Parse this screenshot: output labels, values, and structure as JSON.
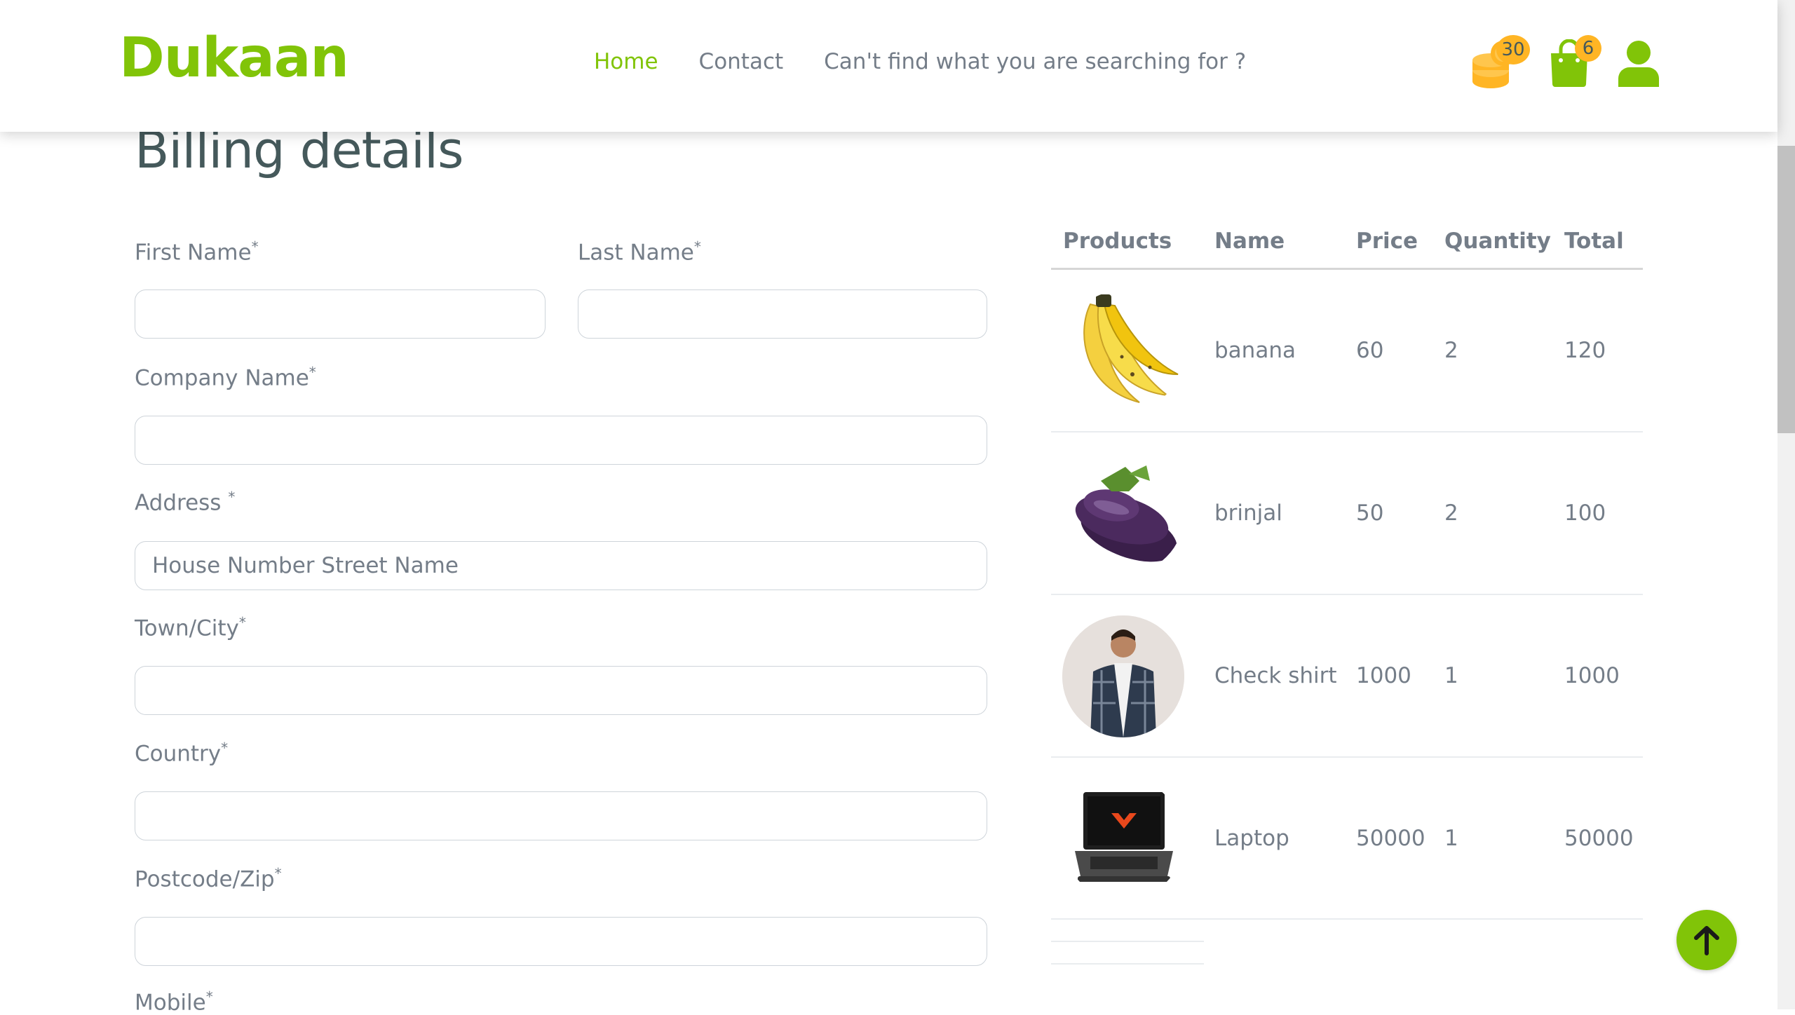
{
  "brand": {
    "logo": "Dukaan",
    "accent": "#81c408",
    "badge_color": "#ffb524"
  },
  "nav": {
    "home": "Home",
    "contact": "Contact",
    "search_prompt": "Can't find what you are searching for ?"
  },
  "header_icons": {
    "coins_count": "30",
    "cart_count": "6"
  },
  "page": {
    "title": "Billing details"
  },
  "form": {
    "first_name": "First Name",
    "last_name": "Last Name",
    "company_name": "Company Name",
    "address": "Address ",
    "address_placeholder": "House Number Street Name",
    "town_city": "Town/City",
    "country": "Country",
    "postcode": "Postcode/Zip",
    "mobile": "Mobile",
    "required_mark": "*"
  },
  "table": {
    "headers": [
      "Products",
      "Name",
      "Price",
      "Quantity",
      "Total"
    ],
    "rows": [
      {
        "image": "banana-image",
        "name": "banana",
        "price": "60",
        "quantity": "2",
        "total": "120"
      },
      {
        "image": "brinjal-image",
        "name": "brinjal",
        "price": "50",
        "quantity": "2",
        "total": "100"
      },
      {
        "image": "shirt-image",
        "name": "Check shirt",
        "price": "1000",
        "quantity": "1",
        "total": "1000"
      },
      {
        "image": "laptop-image",
        "name": "Laptop",
        "price": "50000",
        "quantity": "1",
        "total": "50000"
      }
    ]
  },
  "icons": {
    "coins": "coins-icon",
    "cart": "shopping-bag-icon",
    "user": "user-icon",
    "back_to_top": "arrow-up-icon"
  }
}
